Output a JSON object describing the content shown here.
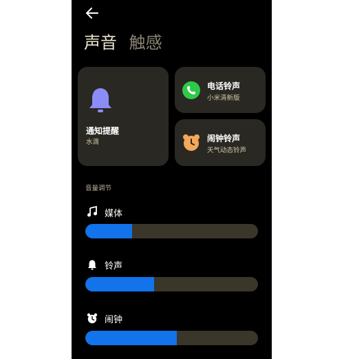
{
  "header": {
    "tabs": [
      {
        "label": "声音"
      },
      {
        "label": "触感"
      }
    ]
  },
  "cards": {
    "notification": {
      "title": "通知提醒",
      "subtitle": "水滴",
      "icon": "bell-icon"
    },
    "phone": {
      "title": "电话铃声",
      "subtitle": "小米清新版",
      "icon": "phone-icon"
    },
    "alarm": {
      "title": "闹钟铃声",
      "subtitle": "天气动态铃声",
      "icon": "alarm-clock-icon"
    }
  },
  "volume": {
    "section_label": "音量调节",
    "rows": [
      {
        "label": "媒体",
        "icon": "music-note-icon",
        "level": 0.27
      },
      {
        "label": "铃声",
        "icon": "bell-icon",
        "level": 0.4
      },
      {
        "label": "闹钟",
        "icon": "alarm-clock-icon",
        "level": 0.53
      }
    ]
  },
  "colors": {
    "accent": "#1273ea",
    "card_bg": "#2a2822",
    "bell": "#8b8cf5",
    "phone_green": "#2fc94a",
    "alarm_orange": "#f4a85a"
  }
}
